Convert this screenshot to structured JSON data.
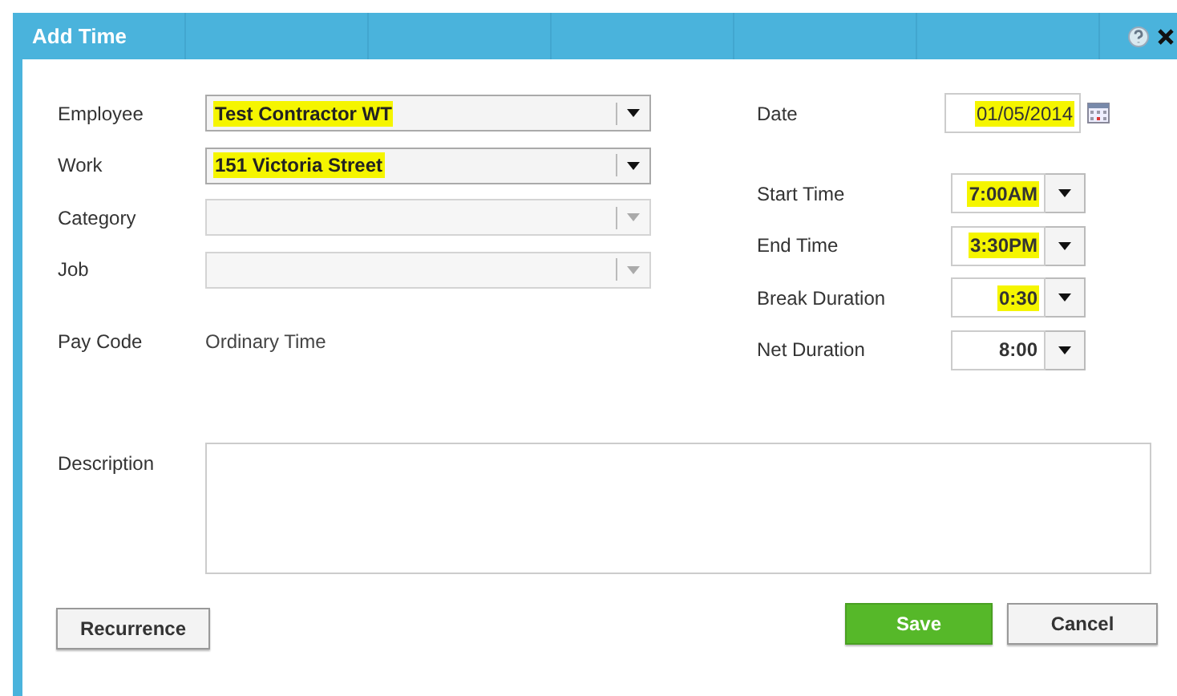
{
  "window": {
    "title": "Add Time"
  },
  "left_fields": [
    {
      "kind": "select",
      "label": "Employee",
      "value": "Test Contractor WT",
      "disabled": false,
      "highlighted": true
    },
    {
      "kind": "select",
      "label": "Work",
      "value": "151 Victoria Street",
      "disabled": false,
      "highlighted": true
    },
    {
      "kind": "select",
      "label": "Category",
      "disabled": true
    },
    {
      "kind": "select",
      "label": "Job",
      "disabled": true
    },
    {
      "kind": "static",
      "label": "Pay Code",
      "value": "Ordinary Time"
    }
  ],
  "right_fields": [
    {
      "kind": "date",
      "label": "Date",
      "value": "01/05/2014",
      "highlighted": true
    },
    {
      "kind": "time",
      "label": "Start Time",
      "value": "7:00AM",
      "highlighted": true
    },
    {
      "kind": "time",
      "label": "End Time",
      "value": "3:30PM",
      "highlighted": true
    },
    {
      "kind": "time",
      "label": "Break Duration",
      "value": "0:30",
      "highlighted": true
    },
    {
      "kind": "time",
      "label": "Net Duration",
      "value": "8:00",
      "highlighted": false
    }
  ],
  "description": {
    "label": "Description"
  },
  "buttons": [
    {
      "kind": "secondary",
      "label": "Recurrence"
    },
    {
      "kind": "primary",
      "label": "Save"
    },
    {
      "kind": "secondary",
      "label": "Cancel"
    }
  ]
}
